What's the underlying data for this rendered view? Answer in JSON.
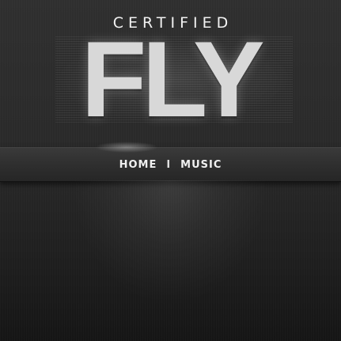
{
  "header": {
    "tagline": "CERTIFIED",
    "logo": "FLY"
  },
  "nav": {
    "items": [
      {
        "label": "HOME"
      },
      {
        "label": "MUSIC"
      }
    ],
    "separator": "I"
  }
}
